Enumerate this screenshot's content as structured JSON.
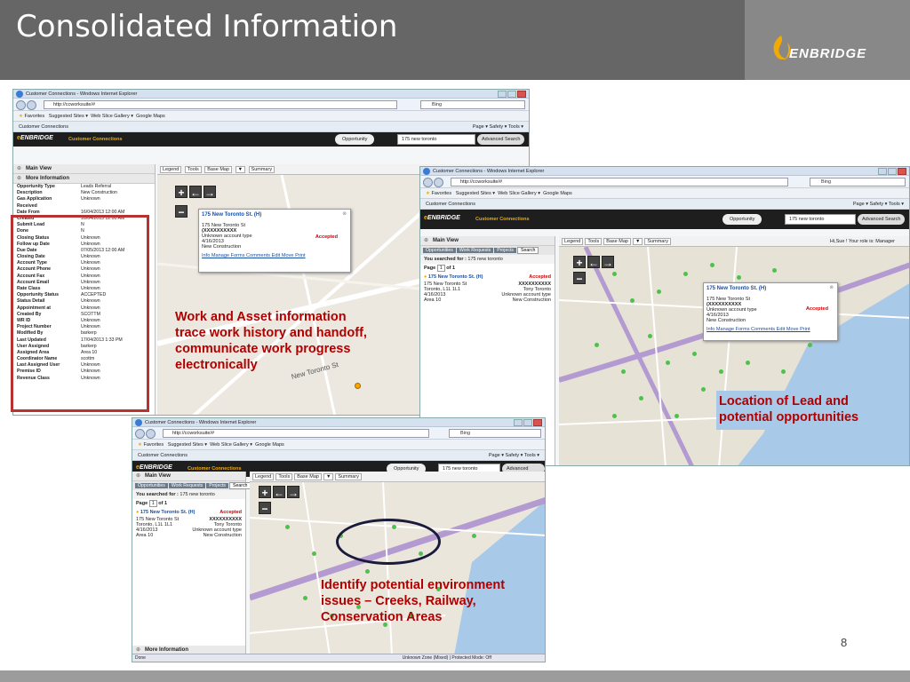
{
  "slide": {
    "title": "Consolidated Information",
    "logo_text": "ENBRIDGE",
    "page_number": "8"
  },
  "browser": {
    "window_title": "Customer Connections - Windows Internet Explorer",
    "url": "http://ccworksuite/#",
    "search_engine": "Bing",
    "favorites": "Favorites",
    "fav_links": [
      "Suggested Sites ▾",
      "Web Slice Gallery ▾",
      "Google Maps"
    ],
    "tab": "Customer Connections",
    "commands": "Page ▾  Safety ▾  Tools ▾"
  },
  "app": {
    "brand": "ENBRIDGE",
    "subtitle": "Customer Connections",
    "search_type": "Opportunity",
    "search_value": "175 new toronto",
    "advanced_search": "Advanced Search",
    "user_role": "Hi,Sue ! Your role is: Manager",
    "map_tools": [
      "Legend",
      "Tools",
      "Base Map",
      "▼",
      "Summary"
    ]
  },
  "window1": {
    "main_view": "Main View",
    "more_info": "More Information",
    "fields": [
      [
        "Opportunity Type",
        "Leads Referral"
      ],
      [
        "Description",
        "New Construction"
      ],
      [
        "Gas Application",
        "Unknown"
      ],
      [
        "Received",
        ""
      ],
      [
        "Date From",
        "16/04/2013 12:00 AM"
      ],
      [
        "Created",
        "16/04/2013 12:00 AM"
      ],
      [
        "Submit Lead",
        "N"
      ],
      [
        "Done",
        "N"
      ],
      [
        "Closing Status",
        "Unknown"
      ],
      [
        "Follow up Date",
        "Unknown"
      ],
      [
        "Due Date",
        "07/05/2013 12:00 AM"
      ],
      [
        "Closing Date",
        "Unknown"
      ],
      [
        "Account Type",
        "Unknown"
      ],
      [
        "Account Phone",
        "Unknown"
      ],
      [
        "Account Fax",
        "Unknown"
      ],
      [
        "Account Email",
        "Unknown"
      ],
      [
        "Rate Class",
        "Unknown"
      ],
      [
        "Opportunity Status",
        "ACCEPTED"
      ],
      [
        "Status Detail",
        "Unknown"
      ],
      [
        "Appointment at",
        "Unknown"
      ],
      [
        "Created By",
        "SCOTTM"
      ],
      [
        "WR ID",
        "Unknown"
      ],
      [
        "Project Number",
        "Unknown"
      ],
      [
        "Modified By",
        "barkerp"
      ],
      [
        "Last Updated",
        "17/04/2013 1:33 PM"
      ],
      [
        "User Assigned",
        "barkerp"
      ],
      [
        "Assigned Area",
        "Area 10"
      ],
      [
        "Coordinator Name",
        "scottm"
      ],
      [
        "Last Assigned User",
        "Unknown"
      ],
      [
        "Premise ID",
        "Unknown"
      ],
      [
        "Revenue Class",
        "Unknown"
      ]
    ],
    "popup": {
      "title": "175 New Toronto St. (H)",
      "lines": [
        "175 New Toronto St",
        "(XXXXXXXXXX",
        "Unknown account type",
        "4/16/2013",
        "New Construction"
      ],
      "status": "Accepted",
      "links": "Info  Manage  Forms  Comments  Edit  Move  Print"
    },
    "street_label": "New Toronto St"
  },
  "result": {
    "tabs": [
      "Opportunities",
      "Work Requests",
      "Projects",
      "Search"
    ],
    "searched_for_label": "You searched for :",
    "searched_for_value": "175 new toronto",
    "page_label": "Page",
    "page_value": "1",
    "page_of": "of 1",
    "title": "175 New Toronto St. (H)",
    "status": "Accepted",
    "left_lines": [
      "175 New Toronto St",
      "Toronto, L1L 1L1",
      "4/16/2013",
      "Area 10"
    ],
    "right_lines": [
      "XXXXXXXXXX",
      "Tony Toronto",
      "Unknown account type",
      "New Construction"
    ]
  },
  "window3": {
    "more_info": "More Information",
    "status_left": "Done",
    "status_right": "Unknown Zone (Mixed) | Protected Mode: Off"
  },
  "notes": {
    "work_asset": "Work and Asset information trace work history and handoff, communicate work progress electronically",
    "location": "Location of Lead and potential opportunities",
    "environment": "Identify potential environment issues – Creeks, Railway, Conservation Areas"
  }
}
